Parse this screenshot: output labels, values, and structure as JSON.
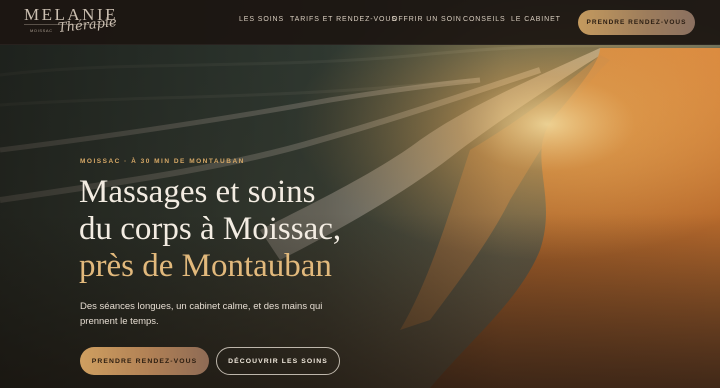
{
  "logo": {
    "main": "MELANIE",
    "script": "Thérapie",
    "sub": "MOISSAC"
  },
  "nav": {
    "items": [
      "LES SOINS",
      "TARIFS ET RENDEZ-VOUS",
      "OFFRIR UN SOIN",
      "CONSEILS",
      "LE CABINET"
    ]
  },
  "header_cta": "PRENDRE RENDEZ-VOUS",
  "hero": {
    "eyebrow": "MOISSAC · À 30 MIN DE MONTAUBAN",
    "title_line1": "Massages et soins",
    "title_line2": "du corps à Moissac,",
    "title_line3": "près de Montauban",
    "lead": "Des séances longues, un cabinet calme, et des mains qui prennent le temps.",
    "cta_primary": "PRENDRE RENDEZ-VOUS",
    "cta_secondary": "DÉCOUVRIR LES SOINS"
  },
  "colors": {
    "accent": "#d6a866",
    "title_highlight": "#e2b97c",
    "header_bg": "#1c1611"
  }
}
